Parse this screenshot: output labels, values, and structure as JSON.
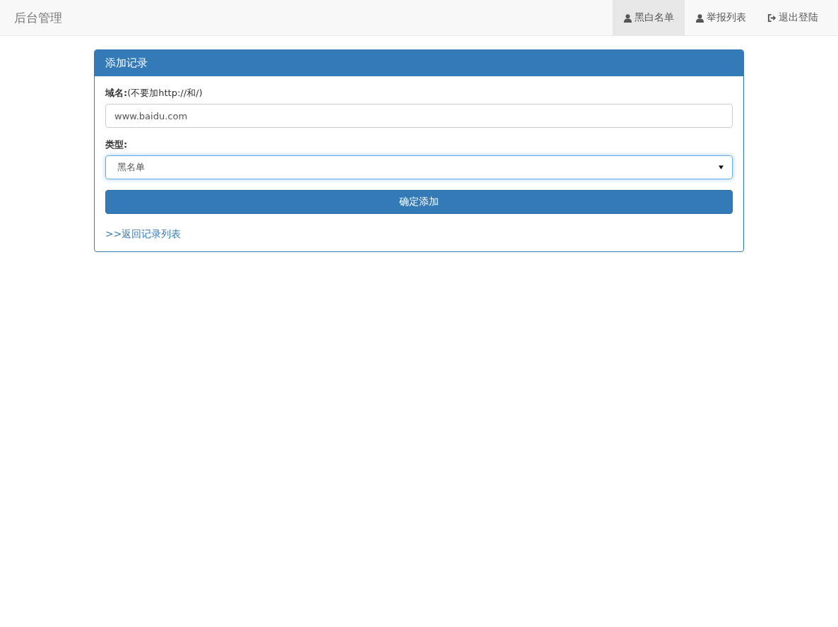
{
  "navbar": {
    "brand": "后台管理",
    "items": [
      {
        "label": "黑白名单",
        "kind": "user",
        "selected": true
      },
      {
        "label": "举报列表",
        "kind": "user",
        "selected": false
      },
      {
        "label": "退出登陆",
        "kind": "logout",
        "selected": false
      }
    ]
  },
  "panel": {
    "title": "添加记录",
    "domain": {
      "label": "**域名:**(不要加http://和/)",
      "value": "www.baidu.com"
    },
    "type": {
      "label": "类型:",
      "value": "黑名单",
      "focused": true
    },
    "submit": "确定添加",
    "back_link": ">>返回记录列表"
  }
}
